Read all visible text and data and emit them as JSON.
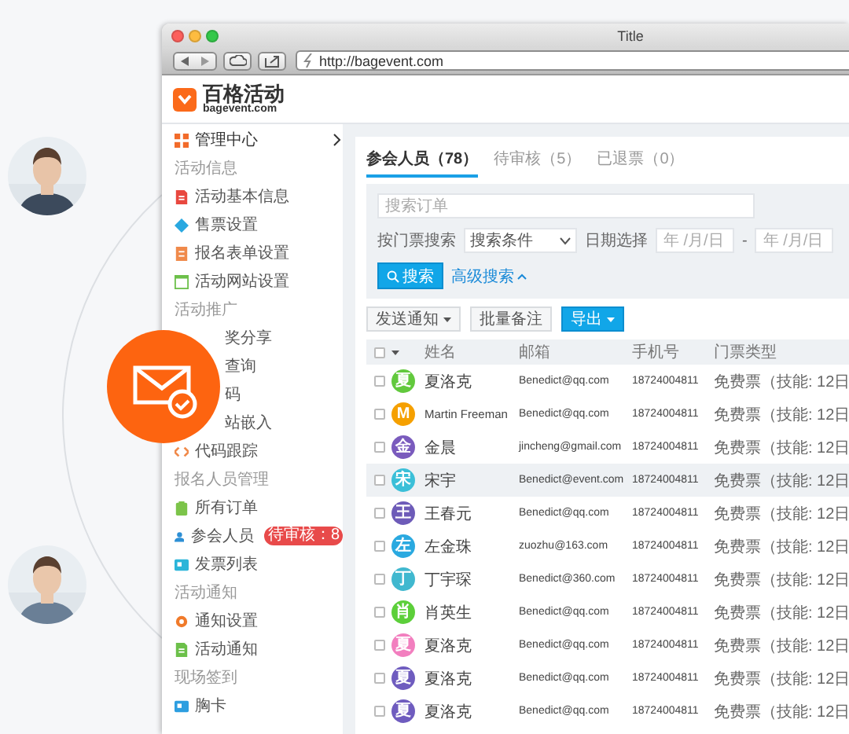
{
  "window": {
    "title": "Title",
    "address": "http://bagevent.com"
  },
  "logo": {
    "name": "百格活动",
    "domain": "bagevent.com"
  },
  "sidebar": {
    "home": {
      "label": "管理中心",
      "kind": "grid",
      "color": "#f26b2a"
    },
    "groups": [
      {
        "title": "活动信息",
        "items": [
          {
            "label": "活动基本信息",
            "kind": "doc",
            "color": "#e8483f"
          },
          {
            "label": "售票设置",
            "kind": "ticket",
            "color": "#29a8e0"
          },
          {
            "label": "报名表单设置",
            "kind": "form",
            "color": "#f08a4b"
          },
          {
            "label": "活动网站设置",
            "kind": "web",
            "color": "#6cc04a"
          }
        ]
      },
      {
        "title": "活动推广",
        "items": [
          {
            "label": "奖分享",
            "kind": "covered"
          },
          {
            "label": "查询",
            "kind": "covered"
          },
          {
            "label": "码",
            "kind": "covered"
          },
          {
            "label": "站嵌入",
            "kind": "covered"
          },
          {
            "label": "代码跟踪",
            "kind": "code",
            "color": "#f08a4b"
          }
        ]
      },
      {
        "title": "报名人员管理",
        "items": [
          {
            "label": "所有订单",
            "kind": "bag",
            "color": "#7cc44a"
          },
          {
            "label": "参会人员",
            "kind": "user",
            "color": "#2d8fd5",
            "badge": "待审核：8"
          },
          {
            "label": "发票列表",
            "kind": "card",
            "color": "#2bb5d9"
          }
        ]
      },
      {
        "title": "活动通知",
        "items": [
          {
            "label": "通知设置",
            "kind": "gear",
            "color": "#f07a2a"
          },
          {
            "label": "活动通知",
            "kind": "doc",
            "color": "#6cc04a"
          }
        ]
      },
      {
        "title": "现场签到",
        "items": [
          {
            "label": "胸卡",
            "kind": "card",
            "color": "#2d9ee0"
          }
        ]
      }
    ]
  },
  "tabs": [
    {
      "label": "参会人员（78）",
      "selected": true
    },
    {
      "label": "待审核（5）",
      "selected": false
    },
    {
      "label": "已退票（0）",
      "selected": false
    }
  ],
  "filters": {
    "search_placeholder": "搜索订单",
    "ticket_label": "按门票搜索",
    "ticket_select": "搜索条件",
    "date_label": "日期选择",
    "date_from_placeholder": "年 /月/日",
    "separator": "-",
    "date_to_placeholder": "年 /月/日",
    "search_button": "搜索",
    "advanced_link": "高级搜索"
  },
  "actions": [
    {
      "label": "发送通知",
      "kind": "default",
      "menu": true
    },
    {
      "label": "批量备注",
      "kind": "default",
      "menu": false
    },
    {
      "label": "导出",
      "kind": "primary",
      "menu": true
    }
  ],
  "table": {
    "header_checked": false,
    "columns": [
      "姓名",
      "邮箱",
      "手机号",
      "门票类型"
    ],
    "rows": [
      {
        "initial": "夏",
        "color": "#62c93d",
        "name": "夏洛克",
        "email": "Benedict@qq.com",
        "phone": "18724004811",
        "ticket": "免费票（技能: 12日",
        "checked": false,
        "selected": false
      },
      {
        "initial": "M",
        "color": "#f5a000",
        "name": "Martin Freeman",
        "email": "Benedict@qq.com",
        "phone": "18724004811",
        "ticket": "免费票（技能: 12日",
        "checked": false,
        "selected": false
      },
      {
        "initial": "金",
        "color": "#7a5bbd",
        "name": "金晨",
        "email": "jincheng@gmail.com",
        "phone": "18724004811",
        "ticket": "免费票（技能: 12日",
        "checked": false,
        "selected": false
      },
      {
        "initial": "宋",
        "color": "#3bbfd8",
        "name": "宋宇",
        "email": "Benedict@event.com",
        "phone": "18724004811",
        "ticket": "免费票（技能: 12日",
        "checked": false,
        "selected": true
      },
      {
        "initial": "王",
        "color": "#6d5bb8",
        "name": "王春元",
        "email": "Benedict@qq.com",
        "phone": "18724004811",
        "ticket": "免费票（技能: 12日",
        "checked": false,
        "selected": false
      },
      {
        "initial": "左",
        "color": "#2aa9e0",
        "name": "左金珠",
        "email": "zuozhu@163.com",
        "phone": "18724004811",
        "ticket": "免费票（技能: 12日",
        "checked": false,
        "selected": false
      },
      {
        "initial": "丁",
        "color": "#40b8cf",
        "name": "丁宇琛",
        "email": "Benedict@360.com",
        "phone": "18724004811",
        "ticket": "免费票（技能: 12日",
        "checked": false,
        "selected": false
      },
      {
        "initial": "肖",
        "color": "#5ccf3a",
        "name": "肖英生",
        "email": "Benedict@qq.com",
        "phone": "18724004811",
        "ticket": "免费票（技能: 12日",
        "checked": false,
        "selected": false
      },
      {
        "initial": "夏",
        "color": "#f27fbf",
        "name": "夏洛克",
        "email": "Benedict@qq.com",
        "phone": "18724004811",
        "ticket": "免费票（技能: 12日",
        "checked": false,
        "selected": false
      },
      {
        "initial": "夏",
        "color": "#6f5cbf",
        "name": "夏洛克",
        "email": "Benedict@qq.com",
        "phone": "18724004811",
        "ticket": "免费票（技能: 12日",
        "checked": false,
        "selected": false
      },
      {
        "initial": "夏",
        "color": "#6f5cbf",
        "name": "夏洛克",
        "email": "Benedict@qq.com",
        "phone": "18724004811",
        "ticket": "免费票（技能: 12日",
        "checked": false,
        "selected": false
      }
    ]
  }
}
